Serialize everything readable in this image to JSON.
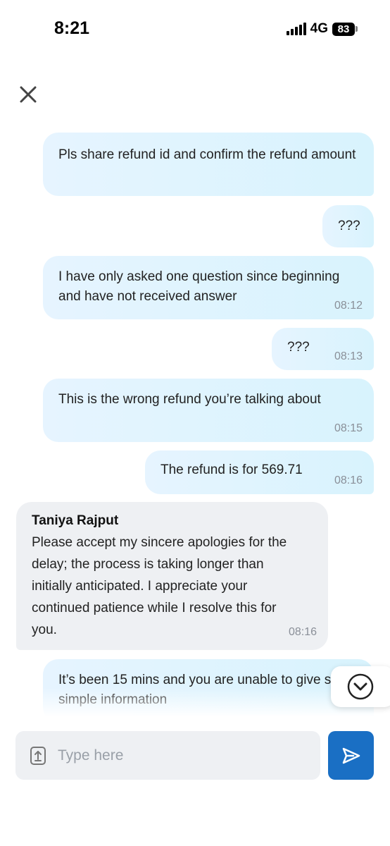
{
  "status_bar": {
    "time": "8:21",
    "network": "4G",
    "battery": "83"
  },
  "header": {
    "close_icon": "close-icon"
  },
  "messages": [
    {
      "direction": "out",
      "text": "Pls share refund id and confirm the refund amount",
      "time": ""
    },
    {
      "direction": "out",
      "text": "???",
      "time": ""
    },
    {
      "direction": "out",
      "text": "I have only asked one question since beginning and have not received answer",
      "time": "08:12"
    },
    {
      "direction": "out",
      "text": "???",
      "time": "08:13"
    },
    {
      "direction": "out",
      "text": "This is the wrong refund you’re talking about",
      "time": "08:15"
    },
    {
      "direction": "out",
      "text": "The refund is for 569.71",
      "time": "08:16"
    },
    {
      "direction": "in",
      "sender": "Taniya Rajput",
      "text": "Please accept my sincere apologies for the delay; the process is taking longer than initially anticipated. I appreciate your continued patience while I resolve this for you.",
      "time": "08:16"
    },
    {
      "direction": "out",
      "text": "It’s been 15 mins and you are unable to give such simple information",
      "time": ""
    }
  ],
  "composer": {
    "placeholder": "Type here",
    "value": ""
  },
  "colors": {
    "outgoing_bubble": "#dff4fe",
    "incoming_bubble": "#eef0f3",
    "send_button": "#1a6fc4",
    "timestamp": "#8a8f98"
  }
}
